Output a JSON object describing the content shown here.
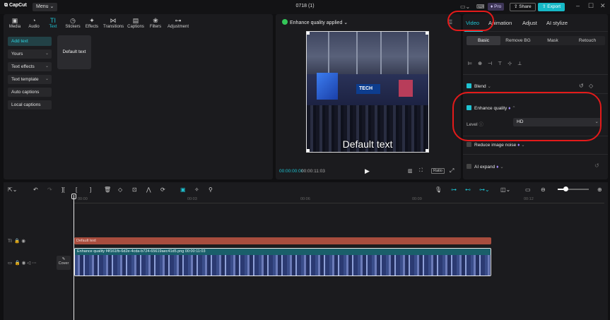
{
  "titlebar": {
    "app_name": "CapCut",
    "menu_label": "Menu",
    "project_title": "0718 (1)",
    "pro_label": "Pro",
    "share_label": "Share",
    "export_label": "Export"
  },
  "left_panel": {
    "toolbar": [
      {
        "label": "Media",
        "icon": "media-icon"
      },
      {
        "label": "Audio",
        "icon": "audio-icon"
      },
      {
        "label": "Text",
        "icon": "text-icon",
        "active": true
      },
      {
        "label": "Stickers",
        "icon": "stickers-icon"
      },
      {
        "label": "Effects",
        "icon": "effects-icon"
      },
      {
        "label": "Transitions",
        "icon": "transitions-icon"
      },
      {
        "label": "Captions",
        "icon": "captions-icon"
      },
      {
        "label": "Filters",
        "icon": "filters-icon"
      },
      {
        "label": "Adjustment",
        "icon": "adjustment-icon"
      }
    ],
    "sidebar": [
      {
        "label": "Add text",
        "active": true
      },
      {
        "label": "Yours",
        "has_caret": true
      },
      {
        "label": "Text effects",
        "has_caret": true
      },
      {
        "label": "Text template",
        "has_caret": true
      },
      {
        "label": "Auto captions"
      },
      {
        "label": "Local captions"
      }
    ],
    "text_card": "Default text"
  },
  "player": {
    "status": "Enhance quality applied",
    "overlay_text": "Default text",
    "sign_text": "TECH",
    "current_time": "00:00:00:00",
    "total_time": "00:00:11:03",
    "ratio_label": "Ratio"
  },
  "right_panel": {
    "tabs": [
      "Video",
      "Animation",
      "Adjust",
      "AI stylize"
    ],
    "active_tab": "Video",
    "subtabs": [
      "Basic",
      "Remove BG",
      "Mask",
      "Retouch"
    ],
    "active_subtab": "Basic",
    "blend_label": "Blend",
    "enhance_label": "Enhance quality",
    "level_label": "Level",
    "level_value": "HD",
    "reduce_noise_label": "Reduce image noise",
    "ai_expand_label": "AI expand"
  },
  "timeline": {
    "ruler_ticks": [
      "00:00",
      "00:03",
      "00:06",
      "00:09",
      "00:12"
    ],
    "text_clip_label": "Default text",
    "video_clip_label": "Enhance quality  f4f161fb-6d2e-4cda-b724-65619aec41d5.png  00:00:11:03",
    "cover_label": "Cover"
  },
  "colors": {
    "accent": "#1fc3d2",
    "annotation": "#e41a1a",
    "text_clip": "#a84d3e",
    "video_clip": "#1f4f5a"
  }
}
